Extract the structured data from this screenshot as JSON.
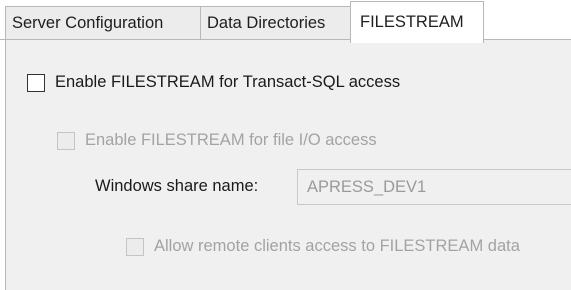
{
  "tabs": [
    {
      "label": "Server Configuration"
    },
    {
      "label": "Data Directories"
    },
    {
      "label": "FILESTREAM"
    }
  ],
  "filestream": {
    "enable_tsql_label": "Enable FILESTREAM for Transact-SQL access",
    "enable_tsql_checked": false,
    "enable_fileio_label": "Enable FILESTREAM for file I/O access",
    "enable_fileio_checked": false,
    "share_name_label": "Windows share name:",
    "share_name_value": "APRESS_DEV1",
    "remote_access_label": "Allow remote clients access to FILESTREAM data",
    "remote_access_checked": false
  }
}
